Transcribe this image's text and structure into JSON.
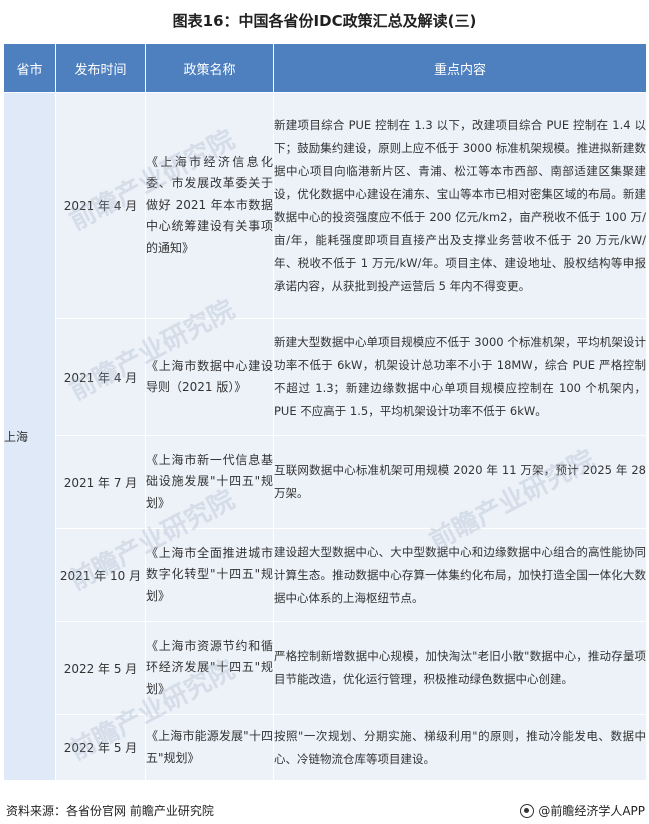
{
  "title": "图表16：中国各省份IDC政策汇总及解读(三)",
  "table": {
    "headers": [
      "省市",
      "发布时间",
      "政策名称",
      "重点内容"
    ],
    "province": "上海",
    "rows": [
      {
        "date": "2021 年 4 月",
        "name": "《上海市经济信息化委、市发展改革委关于做好 2021 年本市数据中心统筹建设有关事项的通知》",
        "content": "新建项目综合 PUE 控制在 1.3 以下，改建项目综合 PUE 控制在 1.4 以下；鼓励集约建设，原则上应不低于 3000 标准机架规模。推进拟新建数据中心项目向临港新片区、青浦、松江等本市西部、南部适建区集聚建设，优化数据中心建设在浦东、宝山等本市已相对密集区域的布局。新建数据中心的投资强度应不低于 200 亿元/km2，亩产税收不低于 100 万/亩/年，能耗强度即项目直接产出及支撑业务营收不低于 20 万元/kW/年、税收不低于 1 万元/kW/年。项目主体、建设地址、股权结构等申报承诺内容，从获批到投产运营后 5 年内不得变更。"
      },
      {
        "date": "2021 年 4 月",
        "name": "《上海市数据中心建设导则（2021 版）》",
        "content": "新建大型数据中心单项目规模应不低于 3000 个标准机架，平均机架设计功率不低于 6kW，机架设计总功率不小于 18MW，综合 PUE 严格控制不超过 1.3；新建边缘数据中心单项目规模应控制在 100 个机架内，PUE 不应高于 1.5，平均机架设计功率不低于 6kW。"
      },
      {
        "date": "2021 年 7 月",
        "name": "《上海市新一代信息基础设施发展\"十四五\"规划》",
        "content": "互联网数据中心标准机架可用规模 2020 年 11 万架，预计 2025 年 28 万架。"
      },
      {
        "date": "2021 年 10 月",
        "name": "《上海市全面推进城市数字化转型\"十四五\"规划》",
        "content": "建设超大型数据中心、大中型数据中心和边缘数据中心组合的高性能协同计算生态。推动数据中心存算一体集约化布局，加快打造全国一体化大数据中心体系的上海枢纽节点。"
      },
      {
        "date": "2022 年 5 月",
        "name": "《上海市资源节约和循环经济发展\"十四五\"规划》",
        "content": "严格控制新增数据中心规模，加快淘汰\"老旧小散\"数据中心，推动存量项目节能改造，优化运行管理，积极推动绿色数据中心创建。"
      },
      {
        "date": "2022 年 5 月",
        "name": "《上海市能源发展\"十四五\"规划》",
        "content": "按照\"一次规划、分期实施、梯级利用\"的原则，推动冷能发电、数据中心、冷链物流仓库等项目建设。"
      }
    ]
  },
  "footer": {
    "source": "资料来源：各省份官网 前瞻产业研究院",
    "brand": "@前瞻经济学人APP"
  },
  "watermark": "前瞻产业研究院"
}
